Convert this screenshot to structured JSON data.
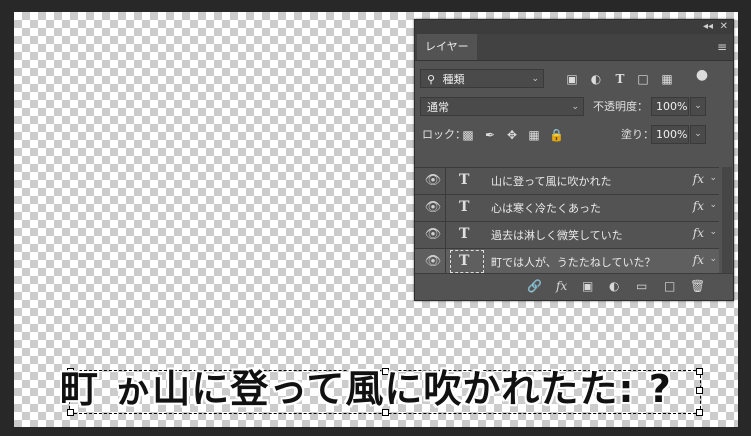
{
  "canvas": {
    "text": "町 ゕ山に登って風に吹かれたた: ?"
  },
  "panel": {
    "tab_label": "レイヤー",
    "collapse_glyph": "◂◂",
    "close_glyph": "✕",
    "menu_glyph": "≡",
    "filter": {
      "search_glyph": "⚲",
      "value": "種類"
    },
    "blend_mode": "通常",
    "opacity_label": "不透明度：",
    "opacity_value": "100%",
    "lock_label": "ロック：",
    "fill_label": "塗り：",
    "fill_value": "100%",
    "layers": [
      {
        "name": "山に登って風に吹かれた",
        "type_glyph": "T",
        "fx": "fx",
        "selected": false
      },
      {
        "name": "心は寒く冷たくあった",
        "type_glyph": "T",
        "fx": "fx",
        "selected": false
      },
      {
        "name": "過去は淋しく微笑していた",
        "type_glyph": "T",
        "fx": "fx",
        "selected": false
      },
      {
        "name": "町では人が、うたたねしていた？",
        "type_glyph": "T",
        "fx": "fx",
        "selected": true
      }
    ],
    "bottom_fx": "fx"
  }
}
